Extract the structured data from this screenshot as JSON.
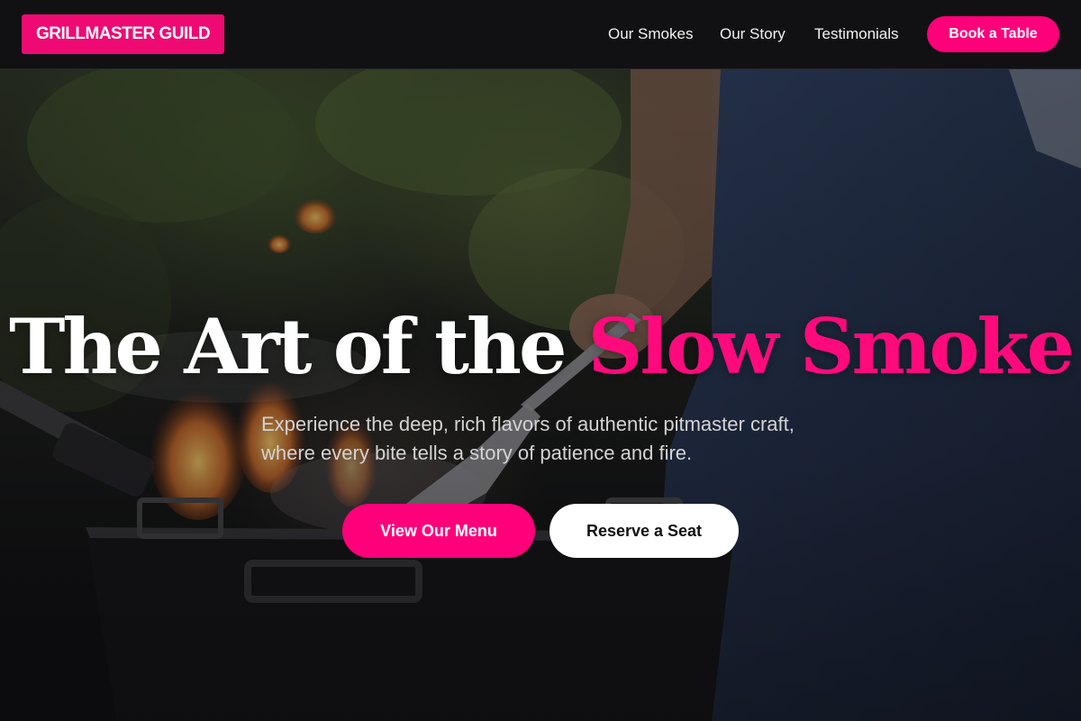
{
  "brand": {
    "logo_text": "GRILLMASTER GUILD"
  },
  "nav": {
    "links": [
      "Our Smokes",
      "Our Story",
      "Testimonials"
    ],
    "cta_label": "Book a Table"
  },
  "hero": {
    "headline_main": "The Art of the",
    "headline_accent": "Slow Smoke",
    "subtitle": "Experience the deep, rich flavors of authentic pitmaster craft, where every bite tells a story of patience and fire.",
    "primary_button": "View Our Menu",
    "secondary_button": "Reserve a Seat",
    "background_image": "pitmaster-grilling-photo"
  },
  "colors": {
    "accent": "#ff007a",
    "header_bg": "#111113",
    "page_bg": "#0d0d0f",
    "secondary_button_bg": "#ffffff"
  }
}
